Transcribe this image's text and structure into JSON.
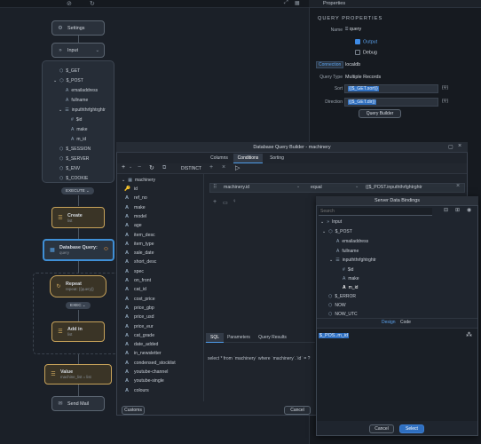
{
  "topbar": {
    "tab_label": "Properties"
  },
  "flow": {
    "settings_label": "Settings",
    "input_label": "Input",
    "input_tree": [
      {
        "label": "$_GET"
      },
      {
        "label": "$_POST"
      },
      {
        "label": "emailaddress"
      },
      {
        "label": "fullname"
      },
      {
        "label": "inpuththrfghtrghtr"
      },
      {
        "label": "$id"
      },
      {
        "label": "make"
      },
      {
        "label": "m_id"
      },
      {
        "label": "$_SESSION"
      },
      {
        "label": "$_SERVER"
      },
      {
        "label": "$_ENV"
      },
      {
        "label": "$_COOKIE"
      }
    ],
    "execute_label": "EXECUTE",
    "create": {
      "title": "Create",
      "sub": "list"
    },
    "dbquery": {
      "title": "Database Query:",
      "sub": "query"
    },
    "repeat": {
      "title": "Repeat",
      "sub": "repeat: {{query}}"
    },
    "exec_label": "EXEC",
    "addin": {
      "title": "Add in",
      "sub": "list"
    },
    "value": {
      "title": "Value",
      "sub": "machine_list = list"
    },
    "sendmail": {
      "title": "Send Mail"
    }
  },
  "props": {
    "section_title": "QUERY PROPERTIES",
    "name_label": "Name",
    "name_value": "query",
    "output_label": "Output",
    "debug_label": "Debug",
    "connection_label": "Connection",
    "connection_value": "localdb",
    "querytype_label": "Query Type",
    "querytype_value": "Multiple Records",
    "sort_label": "Sort",
    "sort_value": "{{$_GET.sort}}",
    "direction_label": "Direction",
    "direction_value": "{{$_GET.dir}}",
    "bind_glyph": "{⚲}",
    "builder_button": "Query Builder"
  },
  "dialog": {
    "title": "Database Query Builder - machinery",
    "tabs": [
      "Columns",
      "Conditions",
      "Sorting"
    ],
    "distinct_label": "DISTINCT",
    "table_name": "machinery",
    "columns": [
      "id",
      "ref_no",
      "make",
      "model",
      "age",
      "item_desc",
      "item_type",
      "sale_date",
      "short_desc",
      "spec",
      "on_front",
      "cat_id",
      "cost_price",
      "price_gbp",
      "price_usd",
      "price_eur",
      "cat_grade",
      "date_added",
      "in_newsletter",
      "condensed_stocklist",
      "youtube-channel",
      "youtube-single",
      "colours"
    ],
    "condition": {
      "field": "machinery.id",
      "operator": "equal",
      "value": "{{$_POST.inpuththrfghtrghtr"
    },
    "bottom_tabs": [
      "SQL",
      "Parameters",
      "Query Results"
    ],
    "sql_text": "select * from `machinery` where `machinery`.`id` = ?",
    "customs_button": "Customs",
    "cancel_button": "Cancel"
  },
  "sdb": {
    "title": "Server Data Bindings",
    "search_placeholder": "Search",
    "tree": [
      {
        "label": "Input"
      },
      {
        "label": "$_POST"
      },
      {
        "label": "emailaddress"
      },
      {
        "label": "fullname"
      },
      {
        "label": "inpuththrfghtrghtr"
      },
      {
        "label": "$id"
      },
      {
        "label": "make"
      },
      {
        "label": "m_id"
      },
      {
        "label": "$_ERROR"
      },
      {
        "label": "NOW"
      },
      {
        "label": "NOW_UTC"
      }
    ],
    "tab_design": "Design",
    "tab_code": "Code",
    "expression": "$_POS..m_id",
    "cancel_button": "Cancel",
    "select_button": "Select"
  },
  "colors": {
    "accent": "#3e8be6",
    "gold": "#c8a35a",
    "bg": "#1a1f27"
  }
}
